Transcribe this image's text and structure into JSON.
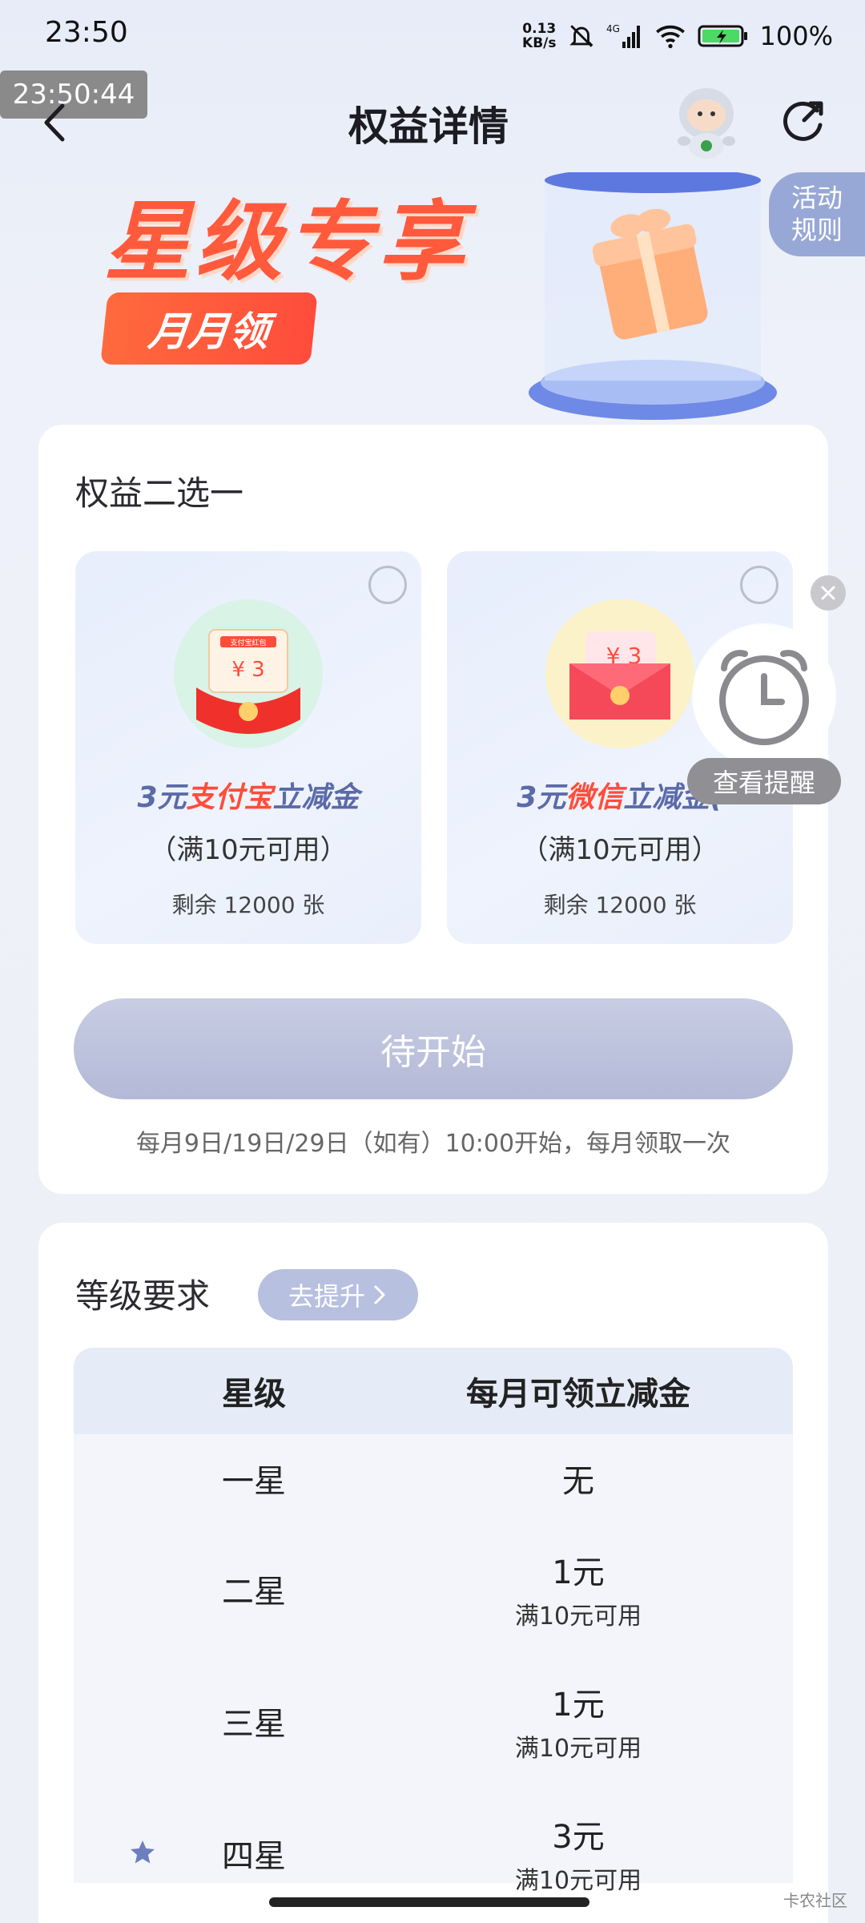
{
  "status_bar": {
    "time": "23:50",
    "net_speed_value": "0.13",
    "net_speed_unit": "KB/s",
    "battery": "100%"
  },
  "overlay_timestamp": "23:50:44",
  "nav": {
    "title": "权益详情"
  },
  "banner": {
    "title": "星级专享",
    "badge": "月月领",
    "rules_line1": "活动",
    "rules_line2": "规则"
  },
  "choose": {
    "title": "权益二选一",
    "options": [
      {
        "name_prefix": "3元",
        "name_highlight": "支付宝",
        "name_suffix": "立减金",
        "coupon_label": "支付宝红包",
        "coupon_amount": "¥ 3",
        "condition": "（满10元可用）",
        "remaining": "剩余 12000 张"
      },
      {
        "name_prefix": "3元",
        "name_highlight": "微信",
        "name_suffix": "立减金(",
        "coupon_amount": "¥ 3",
        "condition": "（满10元可用）",
        "remaining": "剩余 12000 张"
      }
    ],
    "button": "待开始",
    "note": "每月9日/19日/29日（如有）10:00开始，每月领取一次"
  },
  "reminder": {
    "label": "查看提醒"
  },
  "level": {
    "title": "等级要求",
    "upgrade_button": "去提升",
    "headers": [
      "星级",
      "每月可领立减金"
    ],
    "rows": [
      {
        "star": "一星",
        "amount": "无",
        "sub": ""
      },
      {
        "star": "二星",
        "amount": "1元",
        "sub": "满10元可用"
      },
      {
        "star": "三星",
        "amount": "1元",
        "sub": "满10元可用"
      },
      {
        "star": "四星",
        "amount": "3元",
        "sub": "满10元可用",
        "current": true
      }
    ]
  },
  "watermark": "卡农社区",
  "colors": {
    "accent_red": "#ff4d3a",
    "button_disabled": "#b3b9d6",
    "coupon_blue": "#5b6aa8"
  }
}
